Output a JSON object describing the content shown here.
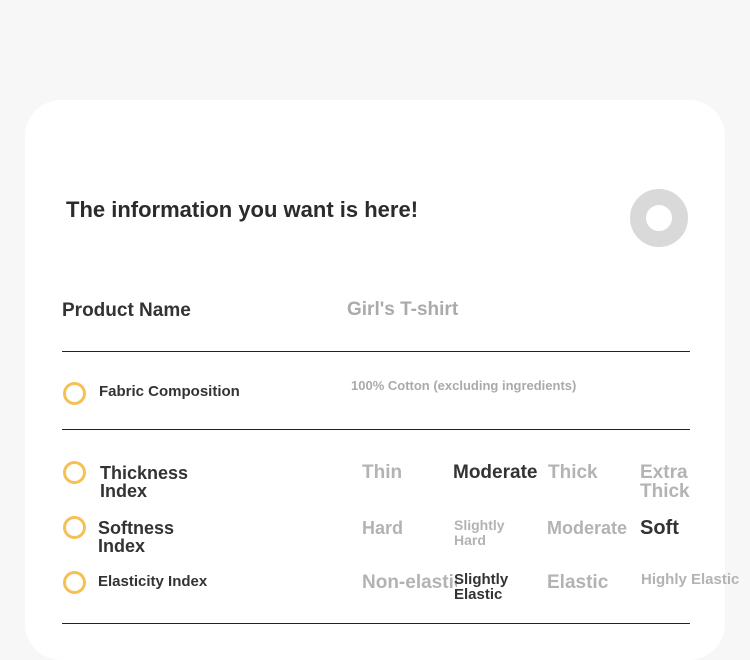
{
  "header": {
    "title": "The information you want is here!"
  },
  "product": {
    "label": "Product Name",
    "value": "Girl's T-shirt"
  },
  "fabric": {
    "label": "Fabric Composition",
    "value": "100% Cotton (excluding ingredients)"
  },
  "thickness": {
    "label": "Thickness Index",
    "options": [
      "Thin",
      "Moderate",
      "Thick",
      "Extra Thick"
    ],
    "selected": "Moderate"
  },
  "softness": {
    "label": "Softness Index",
    "options": [
      "Hard",
      "Slightly Hard",
      "Moderate",
      "Soft"
    ],
    "selected": "Soft"
  },
  "elasticity": {
    "label": "Elasticity Index",
    "options": [
      "Non-elastic",
      "Slightly Elastic",
      "Elastic",
      "Highly Elastic"
    ],
    "selected": "Slightly Elastic"
  },
  "colors": {
    "accent": "#f5c155",
    "ring": "#d9d9d9",
    "text": "#333333",
    "muted": "#aaaaaa"
  }
}
